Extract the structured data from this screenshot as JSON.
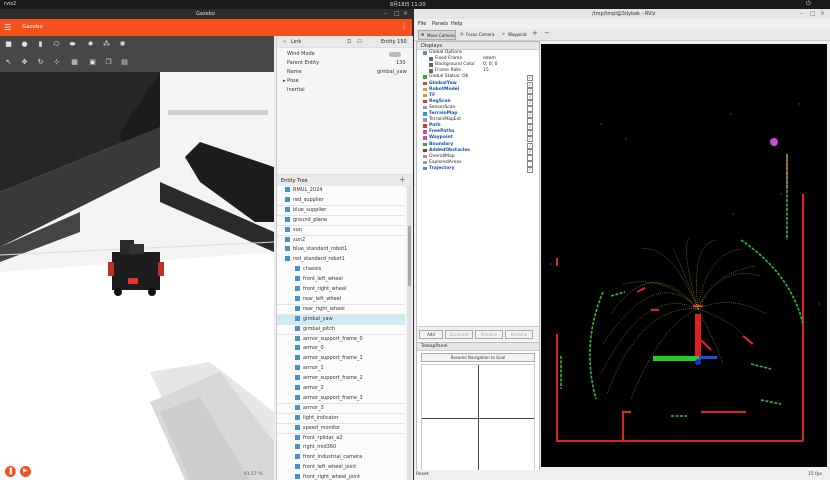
{
  "topbar": {
    "left": "rviz2",
    "clock": "8月18日 11:20"
  },
  "gazebo": {
    "window_title": "Gazebo",
    "app_title": "Gazebo",
    "zoom": "91.57 %",
    "component_panel": {
      "header_label": "Link",
      "header_entity": "Entity 150",
      "rows": [
        {
          "name": "Wind Mode",
          "value": ""
        },
        {
          "name": "Parent Entity",
          "value": "130"
        },
        {
          "name": "Name",
          "value": "gimbal_yaw"
        },
        {
          "name": "Pose",
          "value": ""
        },
        {
          "name": "Inertial",
          "value": ""
        }
      ]
    },
    "entity_tree": {
      "title": "Entity Tree",
      "items": [
        "RMUL_2024",
        "red_supplier",
        "blue_supplier",
        "ground_plane",
        "sun",
        "sun2",
        "blue_standard_robot1",
        "red_standard_robot1",
        "chassis",
        "front_left_wheel",
        "front_right_wheel",
        "rear_left_wheel",
        "rear_right_wheel",
        "gimbal_yaw",
        "gimbal_pitch",
        "armor_support_frame_0",
        "armor_0",
        "armor_support_frame_1",
        "armor_1",
        "armor_support_frame_2",
        "armor_2",
        "armor_support_frame_3",
        "armor_3",
        "light_indicator",
        "speed_monitor",
        "front_rplidar_a2",
        "right_mid360",
        "front_industrial_camera",
        "front_left_wheel_joint",
        "front_right_wheel_joint"
      ],
      "selected": "gimbal_yaw"
    }
  },
  "rviz": {
    "window_title": "/tmp/tmpl@3dykak - RViz",
    "menu": [
      "File",
      "Panels",
      "Help"
    ],
    "tools": [
      "Move Camera",
      "Focus Camera",
      "Waypoint"
    ],
    "displays_title": "Displays",
    "displays": [
      {
        "label": "Global Options",
        "value": "",
        "check": false
      },
      {
        "label": "Fixed Frame",
        "value": "odom",
        "check": false
      },
      {
        "label": "Background Color",
        "value": "0; 0; 0",
        "check": false
      },
      {
        "label": "Frame Rate",
        "value": "15",
        "check": false
      },
      {
        "label": "Global Status: Ok",
        "value": "",
        "check": true
      },
      {
        "label": "GimbalYaw",
        "value": "",
        "check": true
      },
      {
        "label": "RobotModel",
        "value": "",
        "check": true
      },
      {
        "label": "TF",
        "value": "",
        "check": true
      },
      {
        "label": "RegScan",
        "value": "",
        "check": true
      },
      {
        "label": "SensorScan",
        "value": "",
        "check": false
      },
      {
        "label": "TerrainMap",
        "value": "",
        "check": true
      },
      {
        "label": "TerrainMapExt",
        "value": "",
        "check": false
      },
      {
        "label": "Path",
        "value": "",
        "check": true
      },
      {
        "label": "FreePaths",
        "value": "",
        "check": true
      },
      {
        "label": "Waypoint",
        "value": "",
        "check": true
      },
      {
        "label": "Boundary",
        "value": "",
        "check": true
      },
      {
        "label": "AddedObstacles",
        "value": "",
        "check": true
      },
      {
        "label": "OverallMap",
        "value": "",
        "check": false
      },
      {
        "label": "ExploredAreas",
        "value": "",
        "check": false
      },
      {
        "label": "Trajectory",
        "value": "",
        "check": true
      }
    ],
    "buttons": [
      "Add",
      "Duplicate",
      "Remove",
      "Rename"
    ],
    "teleop_title": "TeleopPanel",
    "resume_label": "Resume Navigation to Goal",
    "reset_label": "Reset",
    "fps": "15 fps"
  }
}
